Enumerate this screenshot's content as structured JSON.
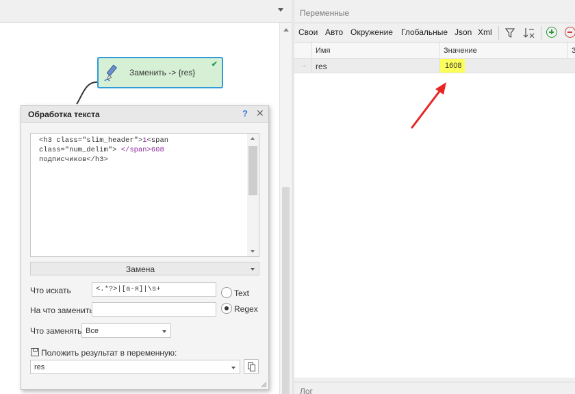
{
  "canvas": {
    "node": {
      "title": "Заменить -> {res}"
    }
  },
  "dialog": {
    "title": "Обработка текста",
    "help_label": "?",
    "close_label": "✕",
    "input_text": {
      "line1_a": "<h3 class=\"slim_header\">",
      "line1_b": "1",
      "line1_c": "<span",
      "line2_a": "class=\"num_delim\">",
      "line2_b": " </span>",
      "line2_c": "608",
      "line3_a": "подписчиков",
      "line3_b": "</h3>"
    },
    "mode": "Замена",
    "search_label": "Что искать",
    "search_value": "<.*?>|[а-я]|\\s+",
    "replace_label": "На что заменить",
    "replace_value": "",
    "radio_text": "Text",
    "radio_regex": "Regex",
    "replace_what_label": "Что заменять",
    "replace_what_value": "Все",
    "save_label": "Положить результат в переменную:",
    "save_var": "res"
  },
  "variables": {
    "title": "Переменные",
    "tabs": [
      "Свои",
      "Авто",
      "Окружение",
      "Глобальные",
      "Json",
      "Xml"
    ],
    "active_tab": "Свои",
    "columns": [
      "Имя",
      "Значение",
      "З"
    ],
    "rows": [
      {
        "indicator": "→",
        "name": "res",
        "value": "1608"
      }
    ],
    "log_title": "Лог"
  },
  "colors": {
    "node_fill": "#d6f0d6",
    "node_border": "#2f9bd8",
    "highlight": "#fdff5a",
    "arrow": "#e82424",
    "add": "#2a9a3a",
    "remove": "#d23a3a"
  },
  "icons": [
    "pen-icon",
    "check-icon",
    "help-icon",
    "close-icon",
    "save-icon",
    "copy-icon",
    "filter-icon",
    "sort-icon",
    "add-icon",
    "remove-icon",
    "arrow-annotation"
  ]
}
